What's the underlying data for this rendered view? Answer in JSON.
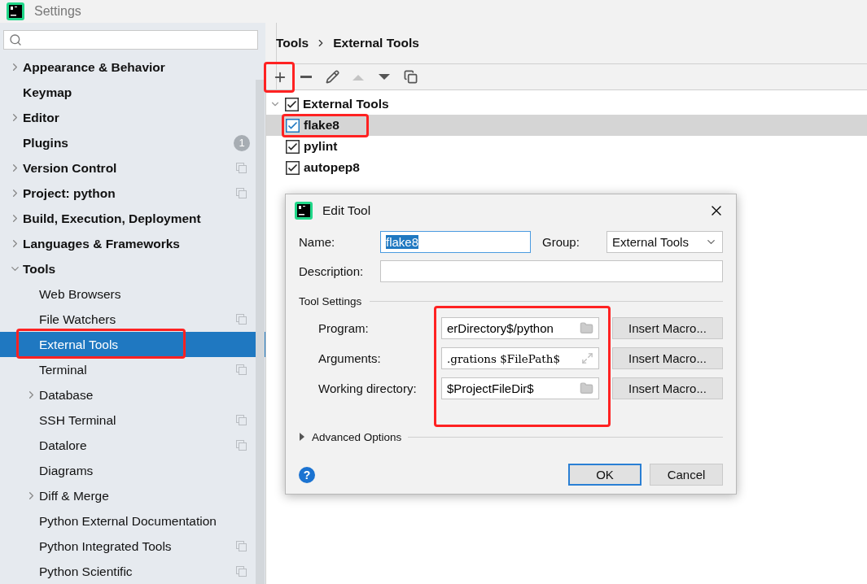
{
  "window": {
    "title": "Settings"
  },
  "sidebar": {
    "items": [
      {
        "label": "Appearance & Behavior",
        "expanded": false
      },
      {
        "label": "Keymap"
      },
      {
        "label": "Editor",
        "expanded": false
      },
      {
        "label": "Plugins",
        "badge": "1"
      },
      {
        "label": "Version Control",
        "expanded": false,
        "project_level": true
      },
      {
        "label": "Project: python",
        "expanded": false,
        "project_level": true
      },
      {
        "label": "Build, Execution, Deployment",
        "expanded": false
      },
      {
        "label": "Languages & Frameworks",
        "expanded": false
      },
      {
        "label": "Tools",
        "expanded": true,
        "children": [
          {
            "label": "Web Browsers",
            "selected": false
          },
          {
            "label": "File Watchers",
            "selected": false,
            "project_level": true
          },
          {
            "label": "External Tools",
            "selected": true,
            "annotated": true
          },
          {
            "label": "Terminal",
            "selected": false,
            "project_level": true
          },
          {
            "label": "Database",
            "selected": false,
            "expanded": false
          },
          {
            "label": "SSH Terminal",
            "selected": false,
            "project_level": true
          },
          {
            "label": "Datalore",
            "selected": false,
            "project_level": true
          },
          {
            "label": "Diagrams",
            "selected": false
          },
          {
            "label": "Diff & Merge",
            "selected": false,
            "expanded": false
          },
          {
            "label": "Python External Documentation",
            "selected": false
          },
          {
            "label": "Python Integrated Tools",
            "selected": false,
            "project_level": true
          },
          {
            "label": "Python Scientific",
            "selected": false,
            "project_level": true
          }
        ]
      }
    ]
  },
  "breadcrumb": [
    "Tools",
    "External Tools"
  ],
  "toolbar": [
    {
      "kind": "add",
      "disabled": false,
      "annotated": true
    },
    {
      "kind": "remove",
      "disabled": false
    },
    {
      "kind": "edit",
      "disabled": false
    },
    {
      "kind": "up",
      "disabled": true
    },
    {
      "kind": "down",
      "disabled": false
    },
    {
      "kind": "copy",
      "disabled": false
    }
  ],
  "tree": {
    "label": "External Tools",
    "checked": true,
    "expanded": true,
    "children": [
      {
        "label": "flake8",
        "checked": true,
        "selected": true,
        "annotated": true
      },
      {
        "label": "pylint",
        "checked": true,
        "selected": false
      },
      {
        "label": "autopep8",
        "checked": true,
        "selected": false
      }
    ]
  },
  "dialog": {
    "title": "Edit Tool",
    "name": {
      "label": "Name:",
      "value": "flake8",
      "text_selected": true
    },
    "group": {
      "label": "Group:",
      "value": "External Tools"
    },
    "description": {
      "label": "Description:"
    },
    "section": "Tool Settings",
    "fields_annotated": true,
    "fields": [
      {
        "label": "Program:",
        "value": "erDirectory$/python",
        "kind": "browse",
        "monospace": false,
        "button": "Insert Macro..."
      },
      {
        "label": "Arguments:",
        "value": ".grations $FilePath$",
        "kind": "expand",
        "monospace": true,
        "button": "Insert Macro..."
      },
      {
        "label": "Working directory:",
        "value": "$ProjectFileDir$",
        "kind": "browse",
        "monospace": false,
        "button": "Insert Macro..."
      }
    ],
    "advanced": {
      "label": "Advanced Options",
      "expanded": false
    },
    "help": "?",
    "buttons": [
      {
        "label": "OK",
        "default": true
      },
      {
        "label": "Cancel",
        "default": false
      }
    ]
  }
}
